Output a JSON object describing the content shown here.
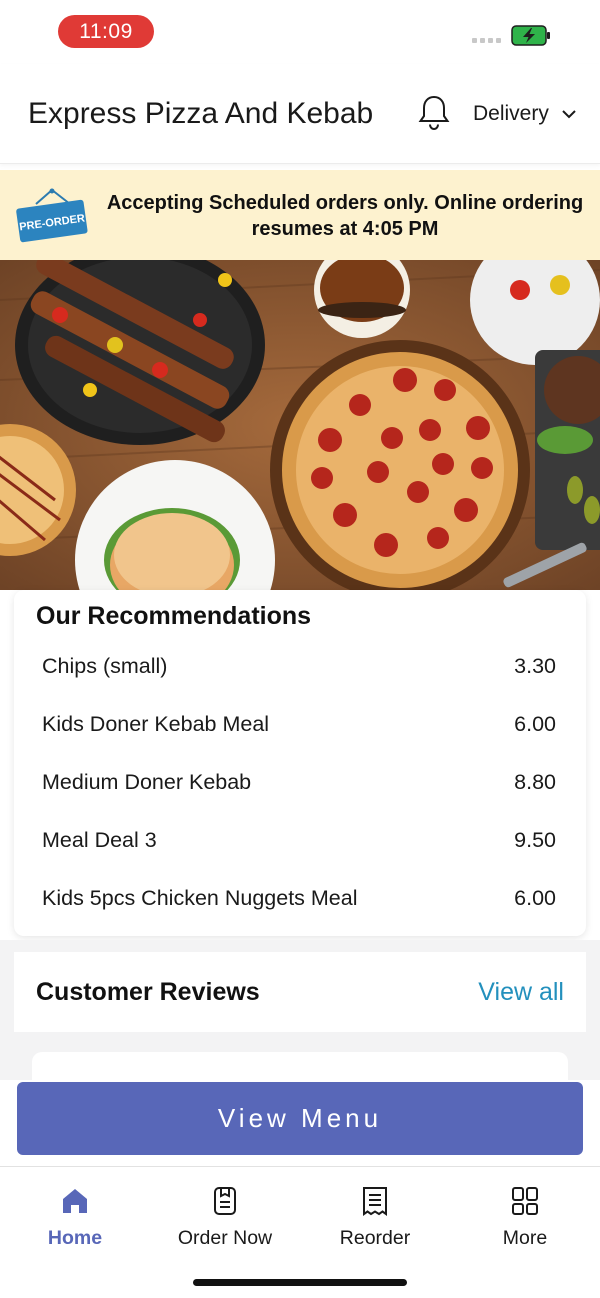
{
  "status_bar": {
    "time": "11:09",
    "battery_color": "#2fb34a",
    "time_pill_color": "#e03a36"
  },
  "header": {
    "store_name": "Express Pizza And Kebab",
    "bell_icon": "bell-icon",
    "order_mode": "Delivery",
    "chevron_icon": "chevron-down-icon"
  },
  "banner": {
    "badge_text": "PRE-ORDER",
    "message": "Accepting Scheduled orders only. Online ordering resumes at 4:05 PM",
    "background": "#fdf2cf"
  },
  "recommendations": {
    "title": "Our Recommendations",
    "items": [
      {
        "name": "Chips (small)",
        "price": "3.30"
      },
      {
        "name": "Kids Doner Kebab Meal",
        "price": "6.00"
      },
      {
        "name": "Medium Doner Kebab",
        "price": "8.80"
      },
      {
        "name": "Meal Deal 3",
        "price": "9.50"
      },
      {
        "name": "Kids 5pcs Chicken Nuggets Meal",
        "price": "6.00"
      }
    ]
  },
  "reviews": {
    "title": "Customer Reviews",
    "view_all": "View all",
    "link_color": "#2390bd"
  },
  "actions": {
    "view_menu": "View Menu",
    "button_color": "#5867b8"
  },
  "tab_bar": {
    "active_color": "#5867b8",
    "tabs": [
      {
        "label": "Home",
        "icon": "home-icon",
        "active": true
      },
      {
        "label": "Order Now",
        "icon": "order-icon",
        "active": false
      },
      {
        "label": "Reorder",
        "icon": "receipt-icon",
        "active": false
      },
      {
        "label": "More",
        "icon": "grid-icon",
        "active": false
      }
    ]
  }
}
